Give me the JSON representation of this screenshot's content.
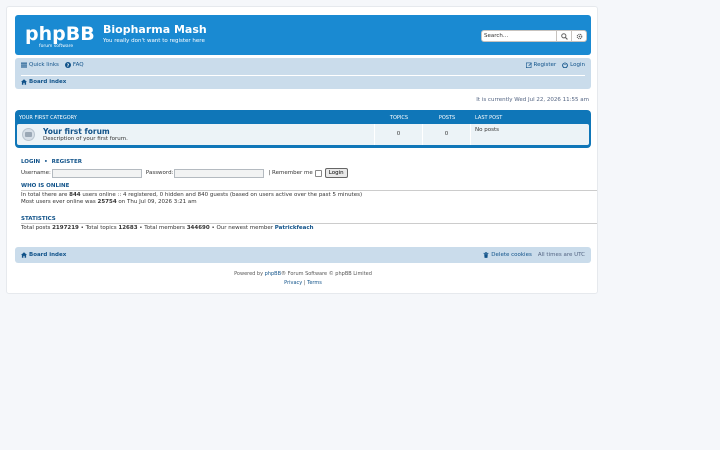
{
  "header": {
    "logo_text": "phpBB",
    "logo_sub": "forum software",
    "site_title": "Biopharma Mash",
    "site_description": "You really don't want to register here",
    "search_placeholder": "Search…"
  },
  "nav": {
    "quick_links": "Quick links",
    "faq": "FAQ",
    "register": "Register",
    "login": "Login",
    "breadcrumb": "Board index"
  },
  "current_time": "It is currently Wed Jul 22, 2026 11:55 am",
  "forums": {
    "category": "Your first category",
    "col_topics": "Topics",
    "col_posts": "Posts",
    "col_last_post": "Last post",
    "rows": [
      {
        "title": "Your first forum",
        "description": "Description of your first forum.",
        "topics": "0",
        "posts": "0",
        "last_post": "No posts"
      }
    ]
  },
  "login_form": {
    "login_link": "LOGIN",
    "separator": "•",
    "register_link": "REGISTER",
    "username_label": "Username:",
    "password_label": "Password:",
    "remember_label": "| Remember me",
    "login_button": "Login"
  },
  "who_is_online": {
    "title": "Who is online",
    "line1_pre": "In total there are ",
    "line1_count": "844",
    "line1_post": " users online :: 4 registered, 0 hidden and 840 guests (based on users active over the past 5 minutes)",
    "line2_pre": "Most users ever online was ",
    "line2_count": "25754",
    "line2_post": " on Thu Jul 09, 2026 3:21 am"
  },
  "statistics": {
    "title": "Statistics",
    "posts_label": "Total posts ",
    "posts": "2197219",
    "topics_label": " • Total topics ",
    "topics": "12683",
    "members_label": " • Total members ",
    "members": "344690",
    "newest_label": " • Our newest member ",
    "newest": "Patrickfeach"
  },
  "footer": {
    "breadcrumb": "Board index",
    "delete_cookies": "Delete cookies",
    "timezone": "All times are UTC",
    "powered_pre": "Powered by ",
    "powered_link": "phpBB",
    "powered_post": "® Forum Software © phpBB Limited",
    "privacy": "Privacy",
    "pipe": " | ",
    "terms": "Terms"
  },
  "colors": {
    "header_bg": "#1a8ad2",
    "navbar_bg": "#cadceb",
    "forum_head_bg": "#0f76b8",
    "link": "#105289"
  }
}
